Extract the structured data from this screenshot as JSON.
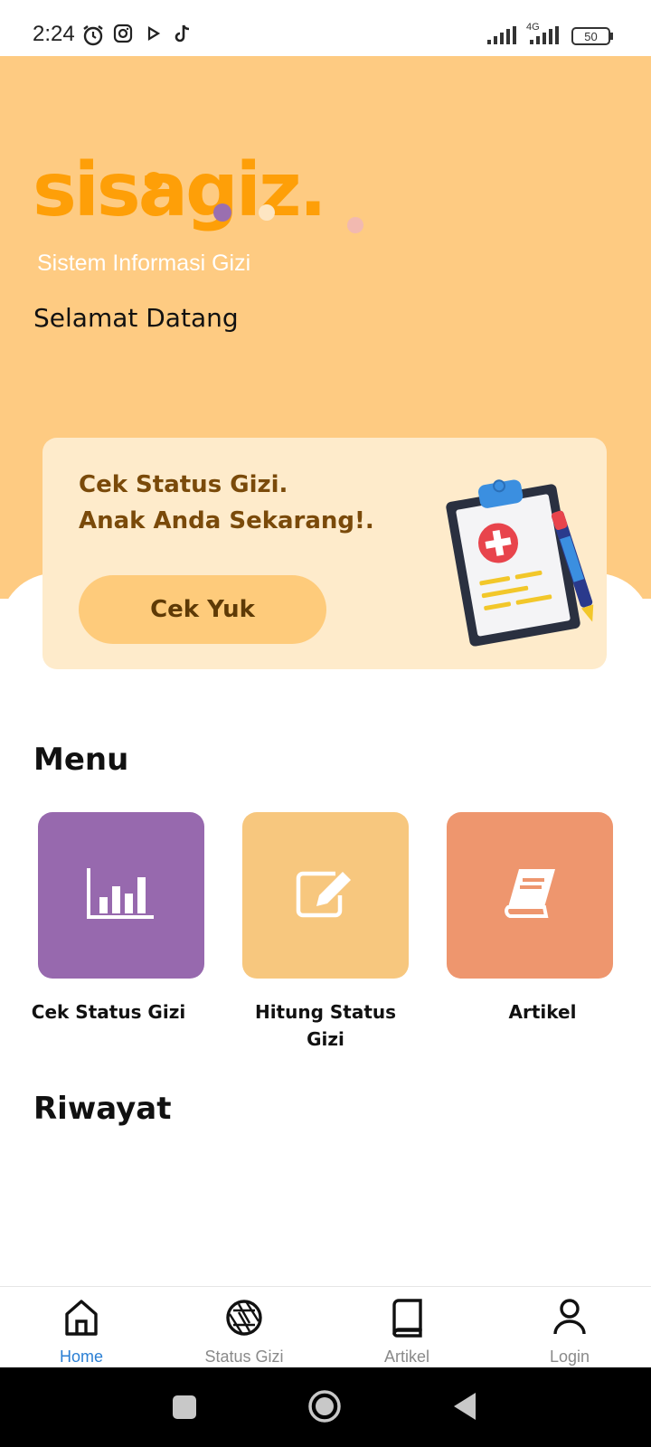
{
  "status_bar": {
    "time": "2:24",
    "network": "4G",
    "battery": "50",
    "icons": [
      "alarm-icon",
      "instagram-icon",
      "play-icon",
      "tiktok-icon",
      "signal-icon",
      "signal-4g-icon",
      "battery-icon"
    ]
  },
  "header": {
    "logo_text": "sisagiz.",
    "tagline": "Sistem Informasi Gizi",
    "welcome": "Selamat Datang"
  },
  "promo": {
    "line1": "Cek Status Gizi.",
    "line2": "Anak Anda Sekarang!.",
    "button_label": "Cek Yuk",
    "illustration": "clipboard-medical-icon"
  },
  "menu": {
    "title": "Menu",
    "items": [
      {
        "label": "Cek Status Gizi",
        "icon": "bar-chart-icon",
        "color": "#9769ae"
      },
      {
        "label": "Hitung Status Gizi",
        "icon": "edit-icon",
        "color": "#f7c77e"
      },
      {
        "label": "Artikel",
        "icon": "book-icon",
        "color": "#ee966e"
      }
    ]
  },
  "history": {
    "title": "Riwayat"
  },
  "bottom_nav": {
    "active": "Home",
    "active_color": "#2a7fd4",
    "items": [
      {
        "label": "Home",
        "icon": "home-icon"
      },
      {
        "label": "Status Gizi",
        "icon": "aperture-icon"
      },
      {
        "label": "Artikel",
        "icon": "book-icon"
      },
      {
        "label": "Login",
        "icon": "user-icon"
      }
    ]
  },
  "colors": {
    "hero": "#fecb82",
    "logo": "#fe9f08",
    "promo_card": "#feebcb",
    "promo_text": "#7a4a0a"
  }
}
